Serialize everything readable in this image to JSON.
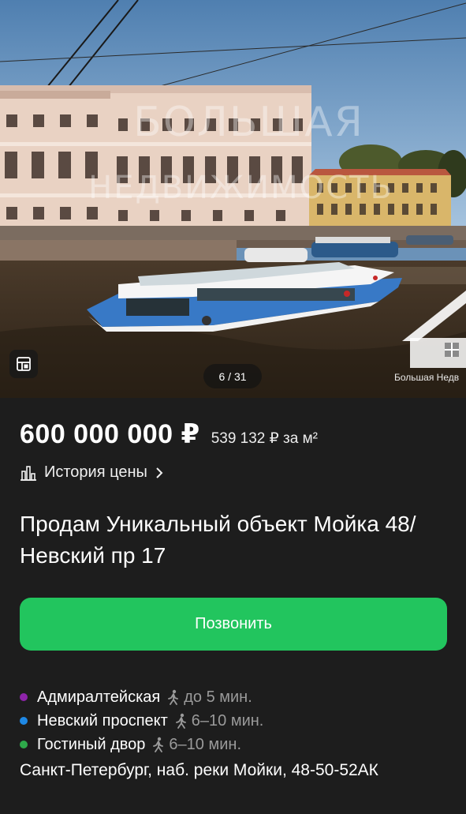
{
  "gallery": {
    "counter": "6 / 31",
    "watermark_line1": "БОЛЬШАЯ",
    "watermark_line2": "НЕДВИЖИМОСТЬ",
    "corner_logo_text": "Большая Недв",
    "gallery_button_icon": "gallery-grid-icon"
  },
  "listing": {
    "price": "600 000 000 ₽",
    "price_per_m2": "539 132 ₽ за м²",
    "price_history_label": "История цены",
    "price_history_icon": "bar-chart-icon",
    "title": "Продам Уникальный объект Мойка 48/Невский пр 17",
    "call_button_label": "Позвонить",
    "metro": [
      {
        "station": "Адмиралтейская",
        "time": "до 5 мин.",
        "color": "#8e24aa"
      },
      {
        "station": "Невский проспект",
        "time": "6–10 мин.",
        "color": "#1e88e5"
      },
      {
        "station": "Гостиный двор",
        "time": "6–10 мин.",
        "color": "#2eaa4a"
      }
    ],
    "address": "Санкт-Петербург, наб. реки Мойки, 48-50-52АК"
  },
  "colors": {
    "background": "#1d1d1d",
    "call_button": "#22c55e"
  }
}
